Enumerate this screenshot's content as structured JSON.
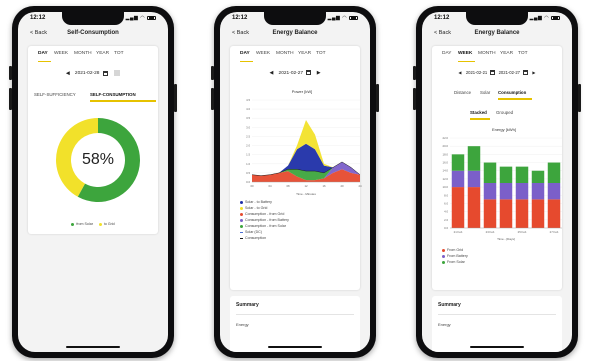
{
  "colors": {
    "accent": "#e6c200",
    "green": "#3da53d",
    "yellow": "#f2e12a",
    "red": "#e64a2e",
    "purple": "#7b5fc9",
    "blue": "#1f2fa8",
    "dark": "#1a1a1a"
  },
  "status_time": "12:12",
  "phones": [
    {
      "back": "< Back",
      "title": "Self-Consumption",
      "tabs": [
        "DAY",
        "WEEK",
        "MONTH",
        "YEAR",
        "TOT"
      ],
      "date": "2021-02-28",
      "subtabs": [
        "SELF-SUFFICIENCY",
        "SELF-CONSUMPTION"
      ],
      "percent": "58%",
      "legend": [
        "from Solar",
        "to Grid"
      ]
    },
    {
      "back": "< Back",
      "title": "Energy Balance",
      "tabs": [
        "DAY",
        "WEEK",
        "MONTH",
        "YEAR",
        "TOT"
      ],
      "date": "2021-02-27",
      "chart_title": "Power [kW]",
      "xlabel": "Time - Minutes",
      "legend": [
        "Solar - to Battery",
        "Solar - to Grid",
        "Consumption - from Grid",
        "Consumption - from Battery",
        "Consumption - from Solar",
        "Solar (DC)",
        "Consumption"
      ],
      "summary_title": "Summary",
      "summary_label": "Energy"
    },
    {
      "back": "< Back",
      "title": "Energy Balance",
      "tabs": [
        "DAY",
        "WEEK",
        "MONTH",
        "YEAR",
        "TOT"
      ],
      "date_from": "2021-02-21",
      "date_to": "2021-02-27",
      "subtabs": [
        "Distance",
        "Solar",
        "Consumption"
      ],
      "modes": [
        "Stacked",
        "Grouped"
      ],
      "chart_title": "Energy [kWh]",
      "xlabel": "Time - [Days]",
      "legend": [
        "From Grid",
        "From Battery",
        "From Solar"
      ],
      "summary_title": "Summary",
      "summary_label": "Energy"
    }
  ],
  "chart_data": [
    {
      "type": "pie",
      "categories": [
        "from Solar",
        "to Grid"
      ],
      "values": [
        58,
        42
      ],
      "center_label": "58%"
    },
    {
      "type": "area",
      "title": "Power [kW]",
      "xlabel": "Time - Minutes",
      "x": [
        0,
        2,
        4,
        6,
        8,
        10,
        12,
        14,
        16,
        18,
        20,
        22,
        24
      ],
      "x_tick_labels": [
        "00",
        "02",
        "04",
        "06",
        "08",
        "10",
        "12",
        "14",
        "16",
        "18",
        "20",
        "22",
        "24"
      ],
      "ylim": [
        0,
        4.5
      ],
      "y_ticks": [
        0,
        0.5,
        1.0,
        1.5,
        2.0,
        2.5,
        3.0,
        3.5,
        4.0,
        4.5
      ],
      "series": [
        {
          "name": "Consumption - from Grid",
          "values": [
            0.4,
            0.35,
            0.4,
            0.5,
            0.6,
            0.3,
            0.1,
            0.1,
            0.2,
            0.5,
            0.7,
            0.5,
            0.4
          ]
        },
        {
          "name": "Consumption - from Battery",
          "values": [
            0.0,
            0.0,
            0.0,
            0.0,
            0.0,
            0.0,
            0.0,
            0.0,
            0.0,
            0.3,
            0.4,
            0.3,
            0.0
          ]
        },
        {
          "name": "Consumption - from Solar",
          "values": [
            0.0,
            0.0,
            0.0,
            0.0,
            0.1,
            0.4,
            0.5,
            0.5,
            0.3,
            0.0,
            0.0,
            0.0,
            0.0
          ]
        },
        {
          "name": "Solar - to Battery",
          "values": [
            0.0,
            0.0,
            0.0,
            0.0,
            0.2,
            1.1,
            1.5,
            1.2,
            0.4,
            0.0,
            0.0,
            0.0,
            0.0
          ]
        },
        {
          "name": "Solar - to Grid",
          "values": [
            0.0,
            0.0,
            0.0,
            0.0,
            0.0,
            0.2,
            1.3,
            0.8,
            0.1,
            0.0,
            0.0,
            0.0,
            0.0
          ]
        }
      ]
    },
    {
      "type": "bar",
      "title": "Energy [kWh]",
      "xlabel": "Time - [Days]",
      "categories": [
        "21 Feb",
        "22 Feb",
        "23 Feb",
        "24 Feb",
        "25 Feb",
        "26 Feb",
        "27 Feb"
      ],
      "x_tick_labels": [
        "21 Feb",
        "23 Feb",
        "25 Feb",
        "27 Feb"
      ],
      "ylim": [
        0,
        22
      ],
      "y_ticks": [
        0,
        2,
        4,
        6,
        8,
        10,
        12,
        14,
        16,
        18,
        20,
        22
      ],
      "series": [
        {
          "name": "From Grid",
          "values": [
            10,
            10,
            7,
            7,
            7,
            7,
            7
          ]
        },
        {
          "name": "From Battery",
          "values": [
            4,
            4,
            4,
            4,
            4,
            4,
            4
          ]
        },
        {
          "name": "From Solar",
          "values": [
            4,
            6,
            5,
            4,
            4,
            3,
            5
          ]
        }
      ]
    }
  ]
}
